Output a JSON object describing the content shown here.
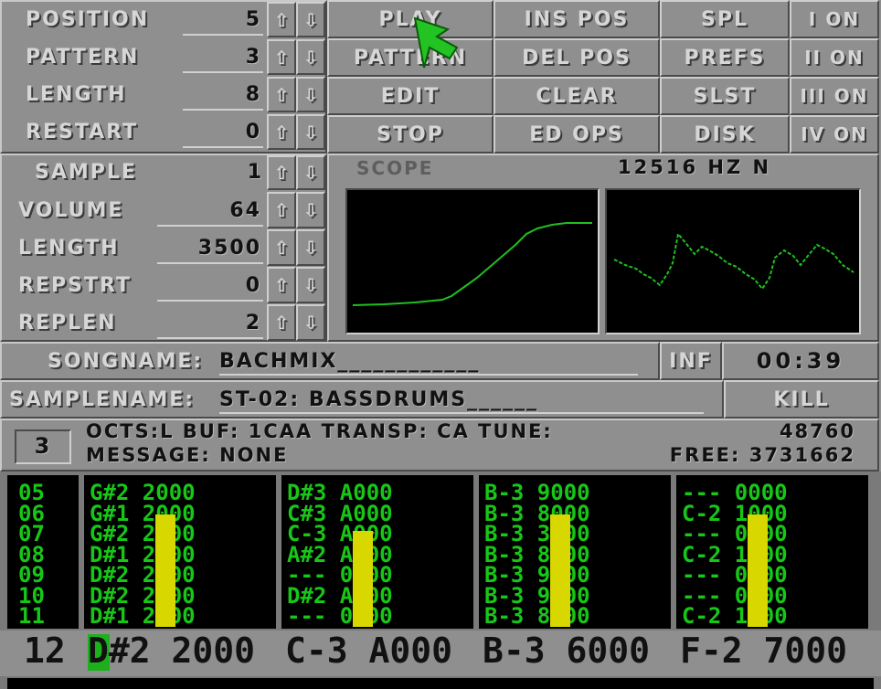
{
  "song": {
    "rows": [
      {
        "label": "POSITION",
        "value": "5"
      },
      {
        "label": "PATTERN",
        "value": "3"
      },
      {
        "label": "LENGTH",
        "value": "8"
      },
      {
        "label": "RESTART",
        "value": "0"
      }
    ]
  },
  "sample": {
    "label": "SAMPLE",
    "value": "1",
    "rows": [
      {
        "label": "VOLUME",
        "value": "64"
      },
      {
        "label": "LENGTH",
        "value": "3500"
      },
      {
        "label": "REPSTRT",
        "value": "0"
      },
      {
        "label": "REPLEN",
        "value": "2"
      }
    ]
  },
  "arrows": {
    "up": "⇧",
    "down": "⇩"
  },
  "buttons": {
    "play": "PLAY",
    "pattern": "PATTERN",
    "edit": "EDIT",
    "stop": "STOP",
    "ins_pos": "INS POS",
    "del_pos": "DEL POS",
    "clear": "CLEAR",
    "ed_ops": "ED OPS",
    "spl": "SPL",
    "prefs": "PREFS",
    "slst": "SLST",
    "disk": "DISK",
    "ch1": "I ON",
    "ch2": "II ON",
    "ch3": "III ON",
    "ch4": "IV ON"
  },
  "scope": {
    "label": "SCOPE",
    "freq": "12516 HZ N"
  },
  "songname": {
    "label": "SONGNAME:",
    "value": "BACHMIX____________"
  },
  "inf": "INF",
  "time": "00:39",
  "samplename": {
    "label": "SAMPLENAME:",
    "value": "ST-02: BASSDRUMS______"
  },
  "kill": "KILL",
  "status": {
    "octave_box": "3",
    "line1_left": "OCTS:L  BUF: 1CAA TRANSP: CA TUNE:",
    "line1_right": "48760",
    "line2_left": "MESSAGE: NONE",
    "line2_right": "FREE: 3731662"
  },
  "pattern": {
    "row_numbers": [
      "05",
      "06",
      "07",
      "08",
      "09",
      "10",
      "11"
    ],
    "channels": [
      {
        "rows": [
          "G#2 2000",
          "G#1 2000",
          "G#2 2000",
          "D#1 2000",
          "D#2 2000",
          "D#2 2000",
          "D#1 2000"
        ],
        "vu_level": 0.76
      },
      {
        "rows": [
          "D#3 A000",
          "C#3 A000",
          "C-3 A000",
          "A#2 A000",
          "--- 0000",
          "D#2 A000",
          "--- 0000"
        ],
        "vu_level": 0.65
      },
      {
        "rows": [
          "B-3 9000",
          "B-3 8000",
          "B-3 3000",
          "B-3 8000",
          "B-3 9000",
          "B-3 9000",
          "B-3 8000"
        ],
        "vu_level": 0.76
      },
      {
        "rows": [
          "--- 0000",
          "C-2 1000",
          "--- 0000",
          "C-2 1000",
          "--- 0000",
          "--- 0000",
          "C-2 1000"
        ],
        "vu_level": 0.76
      }
    ],
    "current": {
      "row": "12",
      "cells": [
        "D#2 2000",
        "C-3 A000",
        "B-3 6000",
        "F-2 7000"
      ]
    }
  },
  "colors": {
    "background": "#8f8f8f",
    "pattern_text": "#18c618",
    "scope_trace": "#1fbf1f",
    "vu_meter": "#d8d800",
    "cursor": "#1db01d",
    "pointer": "#22c322"
  }
}
